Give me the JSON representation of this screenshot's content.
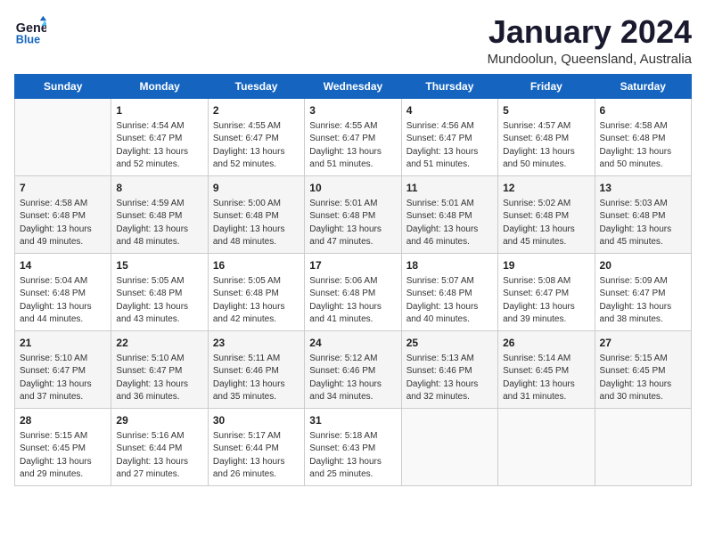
{
  "header": {
    "logo_line1": "General",
    "logo_line2": "Blue",
    "month_title": "January 2024",
    "subtitle": "Mundoolun, Queensland, Australia"
  },
  "days_of_week": [
    "Sunday",
    "Monday",
    "Tuesday",
    "Wednesday",
    "Thursday",
    "Friday",
    "Saturday"
  ],
  "weeks": [
    [
      {
        "day": "",
        "info": ""
      },
      {
        "day": "1",
        "info": "Sunrise: 4:54 AM\nSunset: 6:47 PM\nDaylight: 13 hours\nand 52 minutes."
      },
      {
        "day": "2",
        "info": "Sunrise: 4:55 AM\nSunset: 6:47 PM\nDaylight: 13 hours\nand 52 minutes."
      },
      {
        "day": "3",
        "info": "Sunrise: 4:55 AM\nSunset: 6:47 PM\nDaylight: 13 hours\nand 51 minutes."
      },
      {
        "day": "4",
        "info": "Sunrise: 4:56 AM\nSunset: 6:47 PM\nDaylight: 13 hours\nand 51 minutes."
      },
      {
        "day": "5",
        "info": "Sunrise: 4:57 AM\nSunset: 6:48 PM\nDaylight: 13 hours\nand 50 minutes."
      },
      {
        "day": "6",
        "info": "Sunrise: 4:58 AM\nSunset: 6:48 PM\nDaylight: 13 hours\nand 50 minutes."
      }
    ],
    [
      {
        "day": "7",
        "info": "Sunrise: 4:58 AM\nSunset: 6:48 PM\nDaylight: 13 hours\nand 49 minutes."
      },
      {
        "day": "8",
        "info": "Sunrise: 4:59 AM\nSunset: 6:48 PM\nDaylight: 13 hours\nand 48 minutes."
      },
      {
        "day": "9",
        "info": "Sunrise: 5:00 AM\nSunset: 6:48 PM\nDaylight: 13 hours\nand 48 minutes."
      },
      {
        "day": "10",
        "info": "Sunrise: 5:01 AM\nSunset: 6:48 PM\nDaylight: 13 hours\nand 47 minutes."
      },
      {
        "day": "11",
        "info": "Sunrise: 5:01 AM\nSunset: 6:48 PM\nDaylight: 13 hours\nand 46 minutes."
      },
      {
        "day": "12",
        "info": "Sunrise: 5:02 AM\nSunset: 6:48 PM\nDaylight: 13 hours\nand 45 minutes."
      },
      {
        "day": "13",
        "info": "Sunrise: 5:03 AM\nSunset: 6:48 PM\nDaylight: 13 hours\nand 45 minutes."
      }
    ],
    [
      {
        "day": "14",
        "info": "Sunrise: 5:04 AM\nSunset: 6:48 PM\nDaylight: 13 hours\nand 44 minutes."
      },
      {
        "day": "15",
        "info": "Sunrise: 5:05 AM\nSunset: 6:48 PM\nDaylight: 13 hours\nand 43 minutes."
      },
      {
        "day": "16",
        "info": "Sunrise: 5:05 AM\nSunset: 6:48 PM\nDaylight: 13 hours\nand 42 minutes."
      },
      {
        "day": "17",
        "info": "Sunrise: 5:06 AM\nSunset: 6:48 PM\nDaylight: 13 hours\nand 41 minutes."
      },
      {
        "day": "18",
        "info": "Sunrise: 5:07 AM\nSunset: 6:48 PM\nDaylight: 13 hours\nand 40 minutes."
      },
      {
        "day": "19",
        "info": "Sunrise: 5:08 AM\nSunset: 6:47 PM\nDaylight: 13 hours\nand 39 minutes."
      },
      {
        "day": "20",
        "info": "Sunrise: 5:09 AM\nSunset: 6:47 PM\nDaylight: 13 hours\nand 38 minutes."
      }
    ],
    [
      {
        "day": "21",
        "info": "Sunrise: 5:10 AM\nSunset: 6:47 PM\nDaylight: 13 hours\nand 37 minutes."
      },
      {
        "day": "22",
        "info": "Sunrise: 5:10 AM\nSunset: 6:47 PM\nDaylight: 13 hours\nand 36 minutes."
      },
      {
        "day": "23",
        "info": "Sunrise: 5:11 AM\nSunset: 6:46 PM\nDaylight: 13 hours\nand 35 minutes."
      },
      {
        "day": "24",
        "info": "Sunrise: 5:12 AM\nSunset: 6:46 PM\nDaylight: 13 hours\nand 34 minutes."
      },
      {
        "day": "25",
        "info": "Sunrise: 5:13 AM\nSunset: 6:46 PM\nDaylight: 13 hours\nand 32 minutes."
      },
      {
        "day": "26",
        "info": "Sunrise: 5:14 AM\nSunset: 6:45 PM\nDaylight: 13 hours\nand 31 minutes."
      },
      {
        "day": "27",
        "info": "Sunrise: 5:15 AM\nSunset: 6:45 PM\nDaylight: 13 hours\nand 30 minutes."
      }
    ],
    [
      {
        "day": "28",
        "info": "Sunrise: 5:15 AM\nSunset: 6:45 PM\nDaylight: 13 hours\nand 29 minutes."
      },
      {
        "day": "29",
        "info": "Sunrise: 5:16 AM\nSunset: 6:44 PM\nDaylight: 13 hours\nand 27 minutes."
      },
      {
        "day": "30",
        "info": "Sunrise: 5:17 AM\nSunset: 6:44 PM\nDaylight: 13 hours\nand 26 minutes."
      },
      {
        "day": "31",
        "info": "Sunrise: 5:18 AM\nSunset: 6:43 PM\nDaylight: 13 hours\nand 25 minutes."
      },
      {
        "day": "",
        "info": ""
      },
      {
        "day": "",
        "info": ""
      },
      {
        "day": "",
        "info": ""
      }
    ]
  ]
}
